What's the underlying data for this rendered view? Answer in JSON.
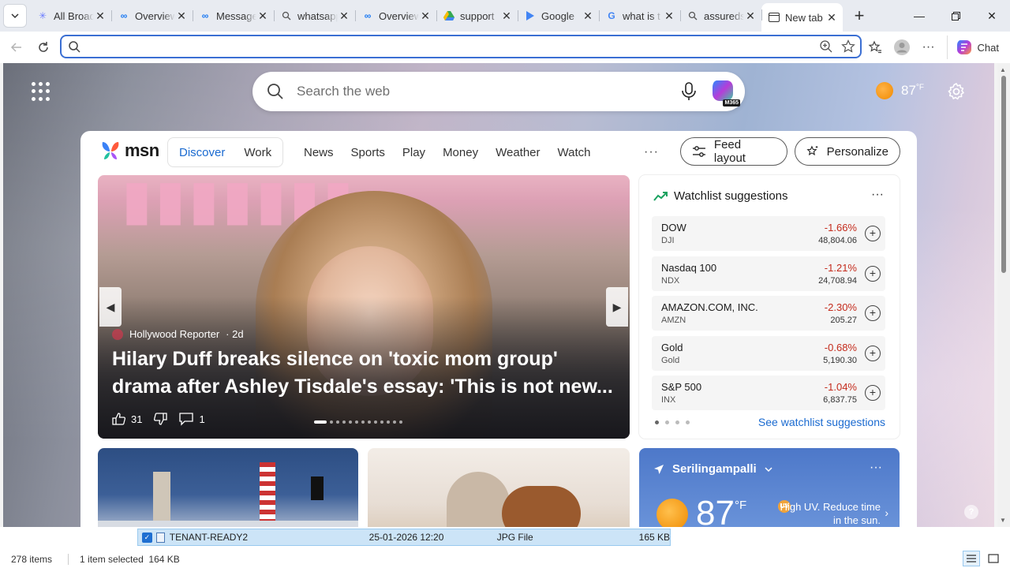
{
  "tabs": [
    {
      "label": "All Broadcasts",
      "icon": "asterisk-icon"
    },
    {
      "label": "Overview",
      "icon": "meta-icon"
    },
    {
      "label": "Messages",
      "icon": "meta-icon"
    },
    {
      "label": "whatsapp",
      "icon": "search-icon"
    },
    {
      "label": "Overview",
      "icon": "meta-icon"
    },
    {
      "label": "support",
      "icon": "drive-icon"
    },
    {
      "label": "Google",
      "icon": "play-icon"
    },
    {
      "label": "what is t",
      "icon": "google-icon"
    },
    {
      "label": "assureds",
      "icon": "search-icon"
    },
    {
      "label": "New tab",
      "icon": "newtab-icon",
      "active": true
    }
  ],
  "toolbar": {
    "address_value": "",
    "chat_label": "Chat"
  },
  "newtab": {
    "search_placeholder": "Search the web",
    "copilot_badge": "M365",
    "weather_temp": "87",
    "weather_unit": "°F"
  },
  "feed": {
    "logo_text": "msn",
    "pills": [
      "Discover",
      "Work"
    ],
    "nav_links": [
      "News",
      "Sports",
      "Play",
      "Money",
      "Weather",
      "Watch"
    ],
    "more": "···",
    "feed_layout_label": "Feed layout",
    "personalize_label": "Personalize",
    "hero": {
      "source": "Hollywood Reporter",
      "age": "· 2d",
      "title": "Hilary Duff breaks silence on 'toxic mom group' drama after Ashley Tisdale's essay: 'This is not new...",
      "likes": "31",
      "comments": "1",
      "dot_count": 13,
      "active_dot": 0
    },
    "watchlist": {
      "title": "Watchlist suggestions",
      "items": [
        {
          "name": "DOW",
          "symbol": "DJI",
          "change": "-1.66%",
          "value": "48,804.06"
        },
        {
          "name": "Nasdaq 100",
          "symbol": "NDX",
          "change": "-1.21%",
          "value": "24,708.94"
        },
        {
          "name": "AMAZON.COM, INC.",
          "symbol": "AMZN",
          "change": "-2.30%",
          "value": "205.27"
        },
        {
          "name": "Gold",
          "symbol": "Gold",
          "change": "-0.68%",
          "value": "5,190.30"
        },
        {
          "name": "S&P 500",
          "symbol": "INX",
          "change": "-1.04%",
          "value": "6,837.75"
        }
      ],
      "link": "See watchlist suggestions"
    },
    "weather_card": {
      "location": "Serilingampalli",
      "temp": "87",
      "unit": "°F",
      "uv_text": "High UV. Reduce time in the sun.",
      "uv_badge": "UV"
    }
  },
  "explorer": {
    "file": {
      "name": "TENANT-READY2",
      "date": "25-01-2026 12:20",
      "type": "JPG File",
      "size": "165 KB"
    },
    "status_count": "278 items",
    "status_selected": "1 item selected  164 KB"
  },
  "colors": {
    "accent": "#1a6ad0",
    "negative": "#c42b1c",
    "address_focus": "#3b6fd3"
  }
}
